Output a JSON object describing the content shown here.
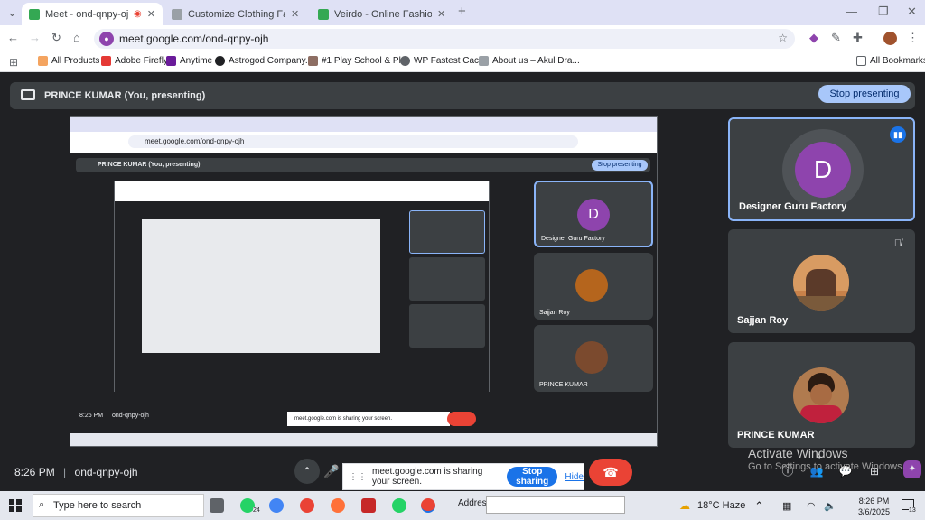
{
  "browser": {
    "tabs": [
      {
        "title": "Meet - ond-qnpy-ojh",
        "active": true
      },
      {
        "title": "Customize Clothing Factory - C",
        "active": false
      },
      {
        "title": "Veirdo - Online Fashion Store fo",
        "active": false
      }
    ],
    "url": "meet.google.com/ond-qnpy-ojh",
    "bookmarks": [
      "All Products",
      "Adobe Firefly",
      "Anytime",
      "Astrogod Company...",
      "#1 Play School & Pl...",
      "WP Fastest Cache",
      "About us – Akul Dra..."
    ],
    "all_bookmarks": "All Bookmarks"
  },
  "meet": {
    "presenting_label": "PRINCE KUMAR (You, presenting)",
    "stop_presenting": "Stop presenting",
    "time": "8:26 PM",
    "code": "ond-qnpy-ojh",
    "participants": [
      {
        "name": "Designer Guru Factory",
        "initial": "D",
        "speaking": true
      },
      {
        "name": "Sajjan Roy",
        "muted": true
      },
      {
        "name": "PRINCE KUMAR"
      }
    ],
    "participant_count": "4",
    "share_banner_text": "meet.google.com is sharing your screen.",
    "stop_sharing": "Stop sharing",
    "hide": "Hide"
  },
  "watermark": {
    "line1": "Activate Windows",
    "line2": "Go to Settings to activate Windows."
  },
  "taskbar": {
    "search_placeholder": "Type here to search",
    "whatsapp_badge": "24",
    "address_label": "Address",
    "weather": "18°C  Haze",
    "time": "8:26 PM",
    "date": "3/6/2025",
    "notifications": "13"
  },
  "colors": {
    "accent": "#1a73e8",
    "avatar": "#8e44ad",
    "hangup": "#ea4335"
  }
}
